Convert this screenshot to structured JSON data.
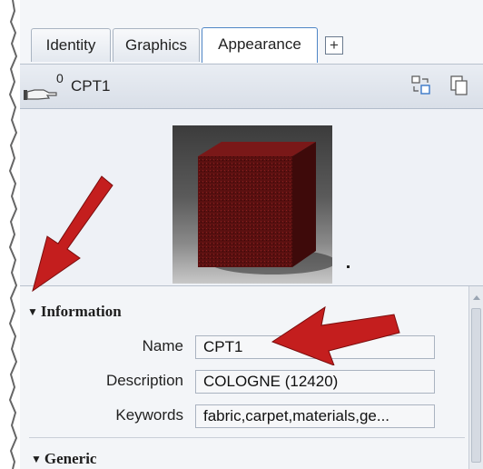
{
  "tabs": [
    {
      "label": "Identity"
    },
    {
      "label": "Graphics"
    },
    {
      "label": "Appearance"
    }
  ],
  "add_tab_label": "+",
  "header": {
    "count": "0",
    "asset_name": "CPT1"
  },
  "sections": {
    "information": {
      "title": "Information",
      "fields": [
        {
          "label": "Name",
          "value": "CPT1"
        },
        {
          "label": "Description",
          "value": "COLOGNE (12420)"
        },
        {
          "label": "Keywords",
          "value": "fabric,carpet,materials,ge..."
        }
      ]
    },
    "generic": {
      "title": "Generic"
    }
  },
  "colors": {
    "arrow": "#c41e1e",
    "active_tab_border": "#4f86c6",
    "cube": "#6e1414"
  },
  "icons": [
    "hand-icon",
    "swap-icon",
    "copy-icon",
    "triangle-down-icon"
  ]
}
